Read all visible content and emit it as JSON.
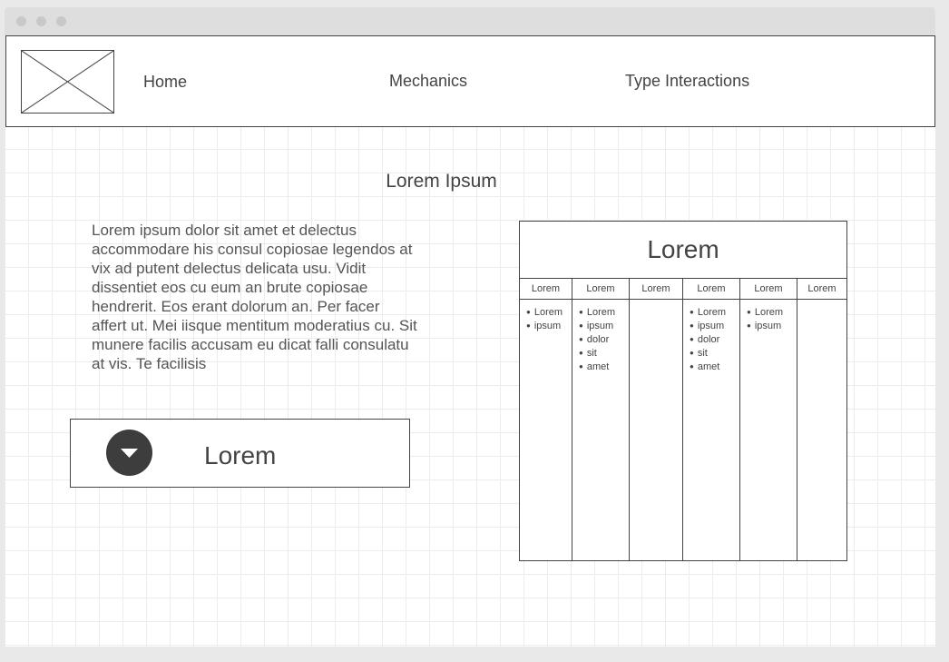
{
  "nav": {
    "links": [
      "Home",
      "Mechanics",
      "Type Interactions"
    ]
  },
  "main": {
    "title": "Lorem Ipsum",
    "paragraph": "Lorem ipsum dolor sit amet et delectus accommodare his consul copiosae legendos at vix ad putent delectus delicata usu. Vidit dissentiet eos cu eum an brute copiosae hendrerit. Eos erant dolorum an. Per facer affert ut. Mei iisque mentitum moderatius cu. Sit munere facilis accusam eu dicat falli consulatu at vis. Te facilisis",
    "dropdown_label": "Lorem"
  },
  "table": {
    "title": "Lorem",
    "columns": [
      {
        "header": "Lorem",
        "items": [
          "Lorem",
          "ipsum"
        ]
      },
      {
        "header": "Lorem",
        "items": [
          "Lorem",
          "ipsum",
          "dolor",
          "sit",
          "amet"
        ]
      },
      {
        "header": "Lorem",
        "items": []
      },
      {
        "header": "Lorem",
        "items": [
          "Lorem",
          "ipsum",
          "dolor",
          "sit",
          "amet"
        ]
      },
      {
        "header": "Lorem",
        "items": [
          "Lorem",
          "ipsum"
        ]
      },
      {
        "header": "Lorem",
        "items": []
      }
    ]
  },
  "icons": {
    "logo": "image-placeholder-icon",
    "dropdown": "caret-down-icon"
  }
}
